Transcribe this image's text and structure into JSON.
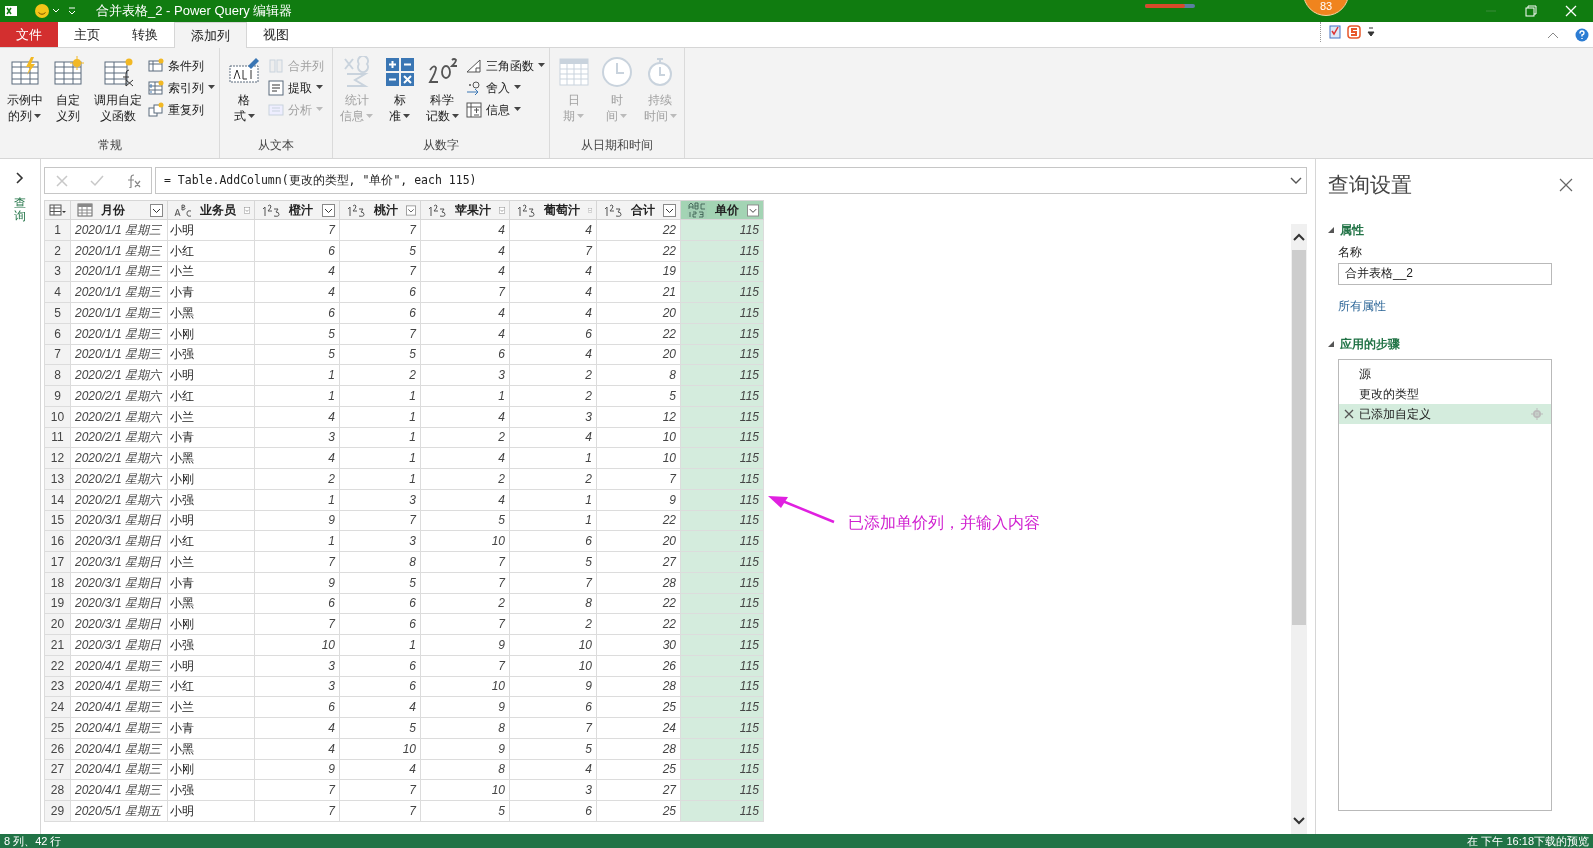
{
  "window": {
    "title": "合并表格_2 - Power Query 编辑器",
    "badge": "83",
    "slider": {
      "level": 0.8
    }
  },
  "tabs": [
    {
      "label": "文件",
      "kind": "file",
      "selected": false
    },
    {
      "label": "主页",
      "kind": "tab",
      "selected": false
    },
    {
      "label": "转换",
      "kind": "tab",
      "selected": false
    },
    {
      "label": "添加列",
      "kind": "tab",
      "selected": true
    },
    {
      "label": "视图",
      "kind": "tab",
      "selected": false
    }
  ],
  "ribbon": [
    {
      "label": "常规",
      "items": [
        {
          "kind": "large",
          "lines": [
            "示例中",
            "的列"
          ],
          "dropdown": true,
          "disabled": false
        },
        {
          "kind": "large",
          "lines": [
            "自定",
            "义列"
          ],
          "dropdown": false,
          "disabled": false
        },
        {
          "kind": "large",
          "lines": [
            "调用自定",
            "义函数"
          ],
          "dropdown": false,
          "disabled": false
        },
        {
          "kind": "small",
          "items": [
            {
              "label": "条件列",
              "dropdown": false,
              "disabled": false
            },
            {
              "label": "索引列",
              "dropdown": true,
              "disabled": false
            },
            {
              "label": "重复列",
              "dropdown": false,
              "disabled": false
            }
          ]
        }
      ]
    },
    {
      "label": "从文本",
      "items": [
        {
          "kind": "large",
          "lines": [
            "格",
            "式"
          ],
          "dropdown": true,
          "disabled": false
        },
        {
          "kind": "small",
          "items": [
            {
              "label": "合并列",
              "dropdown": false,
              "disabled": true
            },
            {
              "label": "提取",
              "dropdown": true,
              "disabled": false
            },
            {
              "label": "分析",
              "dropdown": true,
              "disabled": true
            }
          ]
        }
      ]
    },
    {
      "label": "从数字",
      "items": [
        {
          "kind": "large",
          "lines": [
            "统计",
            "信息"
          ],
          "dropdown": true,
          "disabled": true
        },
        {
          "kind": "large",
          "lines": [
            "标",
            "准"
          ],
          "dropdown": true,
          "disabled": false
        },
        {
          "kind": "large",
          "lines": [
            "科学",
            "记数"
          ],
          "dropdown": true,
          "disabled": false
        },
        {
          "kind": "small",
          "items": [
            {
              "label": "三角函数",
              "dropdown": true,
              "disabled": false
            },
            {
              "label": "舍入",
              "dropdown": true,
              "disabled": false
            },
            {
              "label": "信息",
              "dropdown": true,
              "disabled": false
            }
          ]
        }
      ]
    },
    {
      "label": "从日期和时间",
      "items": [
        {
          "kind": "large",
          "lines": [
            "日",
            "期"
          ],
          "dropdown": true,
          "disabled": true
        },
        {
          "kind": "large",
          "lines": [
            "时",
            "间"
          ],
          "dropdown": true,
          "disabled": true
        },
        {
          "kind": "large",
          "lines": [
            "持续",
            "时间"
          ],
          "dropdown": true,
          "disabled": true
        }
      ]
    }
  ],
  "queries_pane": {
    "label": "查询",
    "expanded": false
  },
  "formula": "= Table.AddColumn(更改的类型, \"单价\", each 115)",
  "table": {
    "columns": [
      {
        "name": "月份",
        "kind": "date",
        "selected": false
      },
      {
        "name": "业务员",
        "kind": "text",
        "selected": false
      },
      {
        "name": "橙汁",
        "kind": "number",
        "selected": false
      },
      {
        "name": "桃汁",
        "kind": "number",
        "selected": false
      },
      {
        "name": "苹果汁",
        "kind": "number",
        "selected": false
      },
      {
        "name": "葡萄汁",
        "kind": "number",
        "selected": false
      },
      {
        "name": "合计",
        "kind": "number",
        "selected": false
      },
      {
        "name": "单价",
        "kind": "any",
        "selected": true
      }
    ],
    "rows": [
      {
        "number": "1",
        "cells": [
          "2020/1/1 星期三",
          "小明",
          "7",
          "7",
          "4",
          "4",
          "22",
          "115"
        ]
      },
      {
        "number": "2",
        "cells": [
          "2020/1/1 星期三",
          "小红",
          "6",
          "5",
          "4",
          "7",
          "22",
          "115"
        ]
      },
      {
        "number": "3",
        "cells": [
          "2020/1/1 星期三",
          "小兰",
          "4",
          "7",
          "4",
          "4",
          "19",
          "115"
        ]
      },
      {
        "number": "4",
        "cells": [
          "2020/1/1 星期三",
          "小青",
          "4",
          "6",
          "7",
          "4",
          "21",
          "115"
        ]
      },
      {
        "number": "5",
        "cells": [
          "2020/1/1 星期三",
          "小黑",
          "6",
          "6",
          "4",
          "4",
          "20",
          "115"
        ]
      },
      {
        "number": "6",
        "cells": [
          "2020/1/1 星期三",
          "小刚",
          "5",
          "7",
          "4",
          "6",
          "22",
          "115"
        ]
      },
      {
        "number": "7",
        "cells": [
          "2020/1/1 星期三",
          "小强",
          "5",
          "5",
          "6",
          "4",
          "20",
          "115"
        ]
      },
      {
        "number": "8",
        "cells": [
          "2020/2/1 星期六",
          "小明",
          "1",
          "2",
          "3",
          "2",
          "8",
          "115"
        ]
      },
      {
        "number": "9",
        "cells": [
          "2020/2/1 星期六",
          "小红",
          "1",
          "1",
          "1",
          "2",
          "5",
          "115"
        ]
      },
      {
        "number": "10",
        "cells": [
          "2020/2/1 星期六",
          "小兰",
          "4",
          "1",
          "4",
          "3",
          "12",
          "115"
        ]
      },
      {
        "number": "11",
        "cells": [
          "2020/2/1 星期六",
          "小青",
          "3",
          "1",
          "2",
          "4",
          "10",
          "115"
        ]
      },
      {
        "number": "12",
        "cells": [
          "2020/2/1 星期六",
          "小黑",
          "4",
          "1",
          "4",
          "1",
          "10",
          "115"
        ]
      },
      {
        "number": "13",
        "cells": [
          "2020/2/1 星期六",
          "小刚",
          "2",
          "1",
          "2",
          "2",
          "7",
          "115"
        ]
      },
      {
        "number": "14",
        "cells": [
          "2020/2/1 星期六",
          "小强",
          "1",
          "3",
          "4",
          "1",
          "9",
          "115"
        ]
      },
      {
        "number": "15",
        "cells": [
          "2020/3/1 星期日",
          "小明",
          "9",
          "7",
          "5",
          "1",
          "22",
          "115"
        ]
      },
      {
        "number": "16",
        "cells": [
          "2020/3/1 星期日",
          "小红",
          "1",
          "3",
          "10",
          "6",
          "20",
          "115"
        ]
      },
      {
        "number": "17",
        "cells": [
          "2020/3/1 星期日",
          "小兰",
          "7",
          "8",
          "7",
          "5",
          "27",
          "115"
        ]
      },
      {
        "number": "18",
        "cells": [
          "2020/3/1 星期日",
          "小青",
          "9",
          "5",
          "7",
          "7",
          "28",
          "115"
        ]
      },
      {
        "number": "19",
        "cells": [
          "2020/3/1 星期日",
          "小黑",
          "6",
          "6",
          "2",
          "8",
          "22",
          "115"
        ]
      },
      {
        "number": "20",
        "cells": [
          "2020/3/1 星期日",
          "小刚",
          "7",
          "6",
          "7",
          "2",
          "22",
          "115"
        ]
      },
      {
        "number": "21",
        "cells": [
          "2020/3/1 星期日",
          "小强",
          "10",
          "1",
          "9",
          "10",
          "30",
          "115"
        ]
      },
      {
        "number": "22",
        "cells": [
          "2020/4/1 星期三",
          "小明",
          "3",
          "6",
          "7",
          "10",
          "26",
          "115"
        ]
      },
      {
        "number": "23",
        "cells": [
          "2020/4/1 星期三",
          "小红",
          "3",
          "6",
          "10",
          "9",
          "28",
          "115"
        ]
      },
      {
        "number": "24",
        "cells": [
          "2020/4/1 星期三",
          "小兰",
          "6",
          "4",
          "9",
          "6",
          "25",
          "115"
        ]
      },
      {
        "number": "25",
        "cells": [
          "2020/4/1 星期三",
          "小青",
          "4",
          "5",
          "8",
          "7",
          "24",
          "115"
        ]
      },
      {
        "number": "26",
        "cells": [
          "2020/4/1 星期三",
          "小黑",
          "4",
          "10",
          "9",
          "5",
          "28",
          "115"
        ]
      },
      {
        "number": "27",
        "cells": [
          "2020/4/1 星期三",
          "小刚",
          "9",
          "4",
          "8",
          "4",
          "25",
          "115"
        ]
      },
      {
        "number": "28",
        "cells": [
          "2020/4/1 星期三",
          "小强",
          "7",
          "7",
          "10",
          "3",
          "27",
          "115"
        ]
      },
      {
        "number": "29",
        "cells": [
          "2020/5/1 星期五",
          "小明",
          "7",
          "7",
          "5",
          "6",
          "25",
          "115"
        ]
      }
    ]
  },
  "annotation": "已添加单价列，并输入内容",
  "settings": {
    "title": "查询设置",
    "properties_heading": "属性",
    "name_label": "名称",
    "name_value": "合并表格__2",
    "all_properties": "所有属性",
    "steps_heading": "应用的步骤",
    "steps": [
      {
        "label": "源",
        "selected": false
      },
      {
        "label": "更改的类型",
        "selected": false
      },
      {
        "label": "已添加自定义",
        "selected": true
      }
    ]
  },
  "status_bar": {
    "left": "8 列、42 行",
    "right": "在 下午 16:18下载的预览"
  }
}
